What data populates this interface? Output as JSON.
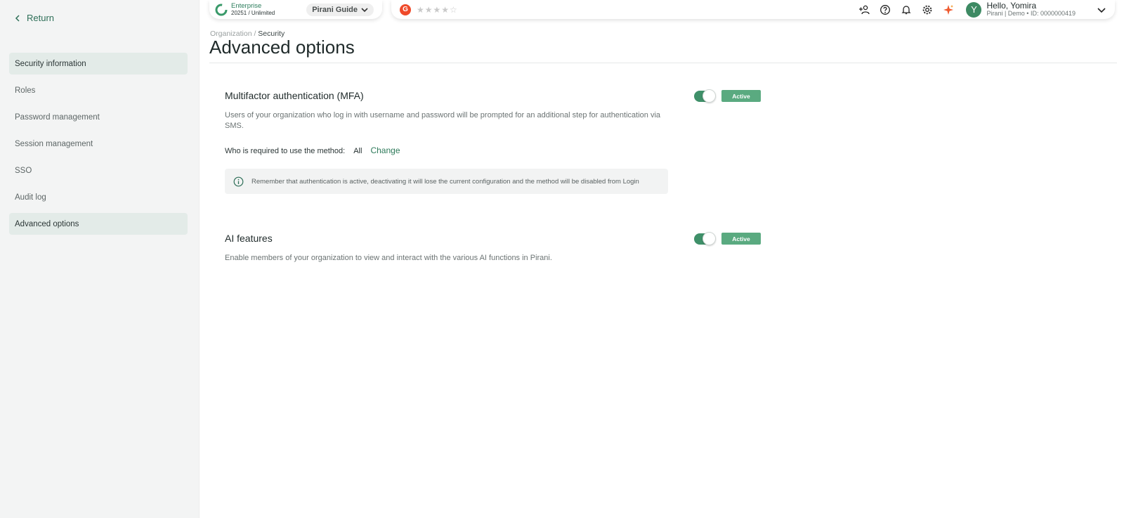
{
  "sidebar": {
    "return_label": "Return",
    "items": [
      {
        "label": "Security information",
        "active": true
      },
      {
        "label": "Roles",
        "active": false
      },
      {
        "label": "Password management",
        "active": false
      },
      {
        "label": "Session management",
        "active": false
      },
      {
        "label": "SSO",
        "active": false
      },
      {
        "label": "Audit log",
        "active": false
      },
      {
        "label": "Advanced options",
        "active": true
      }
    ]
  },
  "topbar": {
    "plan_name": "Enterprise",
    "plan_sub": "20251 / Unlimited",
    "guide_label": "Pirani Guide",
    "rating_stars": "★★★★☆",
    "user_initial": "Y",
    "user_greeting": "Hello, Yomira",
    "user_meta": "Pirani | Demo • ID: 0000000419",
    "icons": [
      "add-user-icon",
      "help-icon",
      "bell-icon",
      "gear-icon",
      "sparkle-icon",
      "chevron-down-icon"
    ]
  },
  "main": {
    "breadcrumb_parent": "Organization /",
    "breadcrumb_current": "Security",
    "title": "Advanced options",
    "mfa": {
      "title": "Multifactor authentication (MFA)",
      "status": "Active",
      "enabled": true,
      "description": "Users of your organization who log in with username and password will be prompted for an additional step for authentication via SMS.",
      "method_label": "Who is required to use the method:",
      "method_value": "All",
      "change_label": "Change",
      "notice": "Remember that authentication is active, deactivating it will lose the current configuration and the method will be disabled from Login"
    },
    "ai": {
      "title": "AI features",
      "status": "Active",
      "enabled": true,
      "description": "Enable members of your organization to view and interact with the various AI functions in Pirani."
    }
  },
  "colors": {
    "accent": "#3f9069",
    "badge": "#5aaa80",
    "active_nav": "#e3ebe8"
  }
}
